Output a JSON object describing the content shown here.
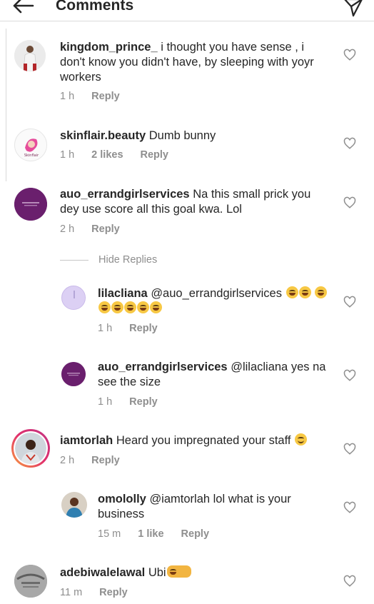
{
  "header": {
    "title": "Comments",
    "back_icon": "back-arrow-icon",
    "share_icon": "direct-send-icon"
  },
  "hide_replies_label": "Hide Replies",
  "comments": [
    {
      "username": "kingdom_prince_",
      "text": "i thought you have sense , i don't know you didn't  have, by sleeping with yoyr workers",
      "time": "1 h",
      "reply": "Reply"
    },
    {
      "username": "skinflair.beauty",
      "text": "Dumb bunny",
      "time": "1 h",
      "likes": "2 likes",
      "reply": "Reply"
    },
    {
      "username": "auo_errandgirlservices",
      "text": "Na this small prick you dey use score all this goal kwa. Lol",
      "time": "2 h",
      "reply": "Reply"
    },
    {
      "username": "lilacliana",
      "text": "@auo_errandgirlservices",
      "time": "1 h",
      "reply": "Reply"
    },
    {
      "username": "auo_errandgirlservices",
      "text": "@lilacliana yes na see the size",
      "time": "1 h",
      "reply": "Reply"
    },
    {
      "username": "iamtorlah",
      "text": "Heard you impregnated your staff",
      "time": "2 h",
      "reply": "Reply"
    },
    {
      "username": "omololly",
      "text": "@iamtorlah lol what is your business",
      "time": "15 m",
      "likes": "1 like",
      "reply": "Reply"
    },
    {
      "username": "adebiwalelawal",
      "text": "Ubi",
      "time": "11 m",
      "reply": "Reply"
    }
  ],
  "colors": {
    "text": "#262626",
    "meta": "#8e8e8e",
    "divider": "#dbdbdb",
    "brand_purple": "#6a1f6d",
    "story_ring": "#e1306c"
  }
}
